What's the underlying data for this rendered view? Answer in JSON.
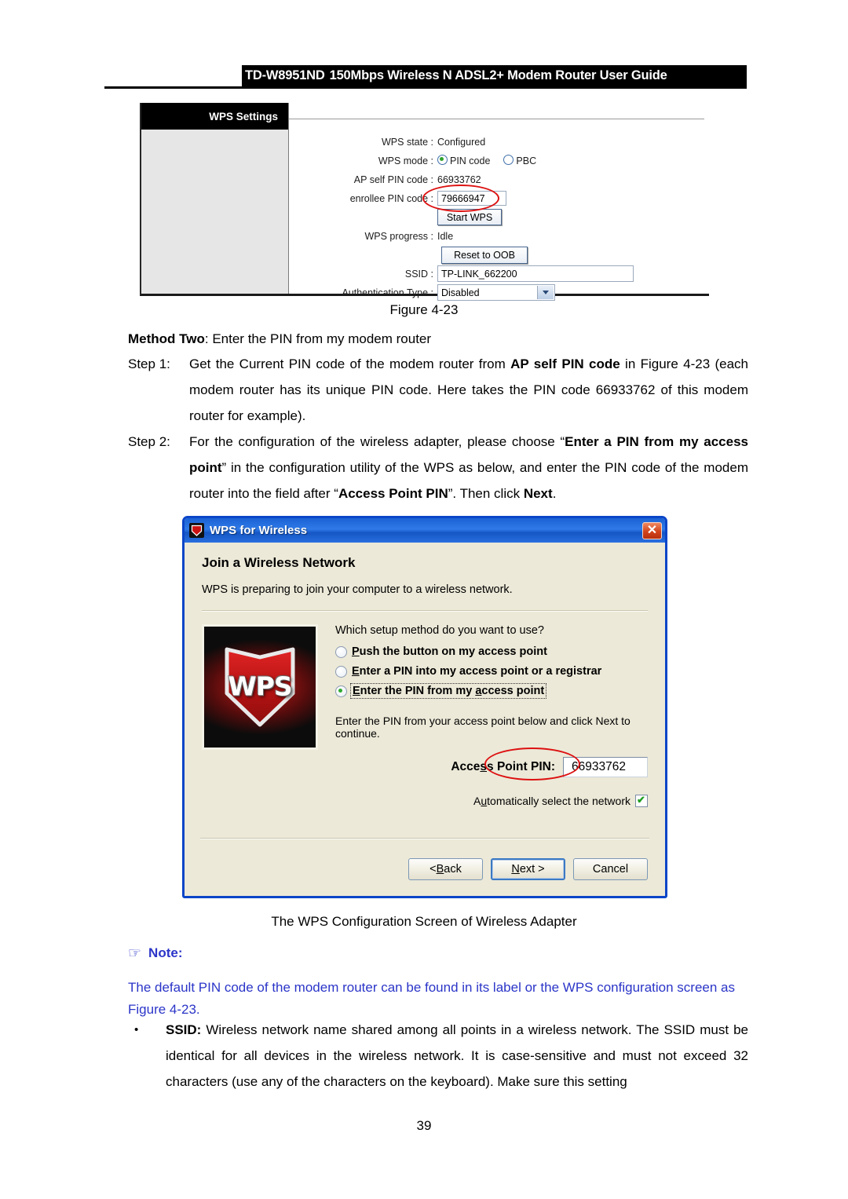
{
  "header": {
    "model": "TD-W8951ND",
    "title": "150Mbps Wireless N ADSL2+ Modem Router User Guide"
  },
  "wps_settings_figure": {
    "panel_title": "WPS Settings",
    "rows": {
      "wps_state_label": "WPS state :",
      "wps_state_value": "Configured",
      "wps_mode_label": "WPS mode :",
      "wps_mode_pin_label": "PIN code",
      "wps_mode_pbc_label": "PBC",
      "ap_self_pin_label": "AP self PIN code :",
      "ap_self_pin_value": "66933762",
      "enrollee_pin_label": "enrollee PIN code :",
      "enrollee_pin_value": "79666947",
      "start_wps_button": "Start WPS",
      "wps_progress_label": "WPS progress :",
      "wps_progress_value": "Idle",
      "reset_oob_button": "Reset to OOB",
      "ssid_label": "SSID :",
      "ssid_value": "TP-LINK_662200",
      "auth_type_label": "Authentication Type :",
      "auth_type_value": "Disabled"
    },
    "caption": "Figure 4-23"
  },
  "body": {
    "method_two_bold": "Method Two",
    "method_two_rest": ": Enter the PIN from my modem router",
    "step1": {
      "label": "Step 1:",
      "part1": "Get the Current PIN code of the modem router from ",
      "bold1": "AP self PIN code",
      "part2": " in Figure 4-23 (each modem router has its unique PIN code. Here takes the PIN code 66933762 of this modem router for example)."
    },
    "step2": {
      "label": "Step 2:",
      "part1": "For the configuration of the wireless adapter, please choose “",
      "bold1": "Enter a PIN from my access point",
      "part2": "” in the configuration utility of the WPS as below, and enter the PIN code of the modem router into the field after “",
      "bold2": "Access Point PIN",
      "part3": "”. Then click ",
      "bold3": "Next",
      "part4": "."
    }
  },
  "wps_dialog": {
    "window_title": "WPS for Wireless",
    "icon_label": "WPS",
    "close_label": "✕",
    "heading": "Join a Wireless Network",
    "subtext": "WPS is preparing to join your computer to a wireless network.",
    "logo_text": "WPS",
    "question": "Which setup method do you want to use?",
    "options": [
      {
        "label": "Push the button on my access point",
        "accesskey": "P",
        "selected": false,
        "focused": false
      },
      {
        "label": "Enter a PIN into my access point or a registrar",
        "accesskey": "E",
        "selected": false,
        "focused": false
      },
      {
        "label": "Enter the PIN from my access point",
        "accesskey": "E",
        "selected": true,
        "focused": true
      }
    ],
    "hint": "Enter the PIN from your access point below and click Next to continue.",
    "pin_label_pre": "Acce",
    "pin_label_key": "s",
    "pin_label_post": "s Point PIN:",
    "pin_value": "66933762",
    "auto_select_pre": "A",
    "auto_select_key": "u",
    "auto_select_post": "tomatically select the network",
    "auto_select_checked": true,
    "buttons": {
      "back": "< Back",
      "back_key": "B",
      "next": "Next >",
      "next_key": "N",
      "cancel": "Cancel"
    },
    "caption": "The WPS Configuration Screen of Wireless Adapter"
  },
  "note": {
    "hand_icon": "☞",
    "title": "Note:",
    "text": "The default PIN code of the modem router can be found in its label or the WPS configuration screen as Figure 4-23."
  },
  "bullet": {
    "dot": "•",
    "bold": "SSID:",
    "text": " Wireless network name shared among all points in a wireless network. The SSID must be identical for all devices in the wireless network. It is case-sensitive and must not exceed 32 characters (use any of the characters on the keyboard). Make sure this setting"
  },
  "page_number": "39",
  "colors": {
    "note_blue": "#2b35c8",
    "annotation_red": "#dd1111",
    "titlebar_blue": "#1b62d4",
    "dialog_face": "#ece9d8"
  }
}
